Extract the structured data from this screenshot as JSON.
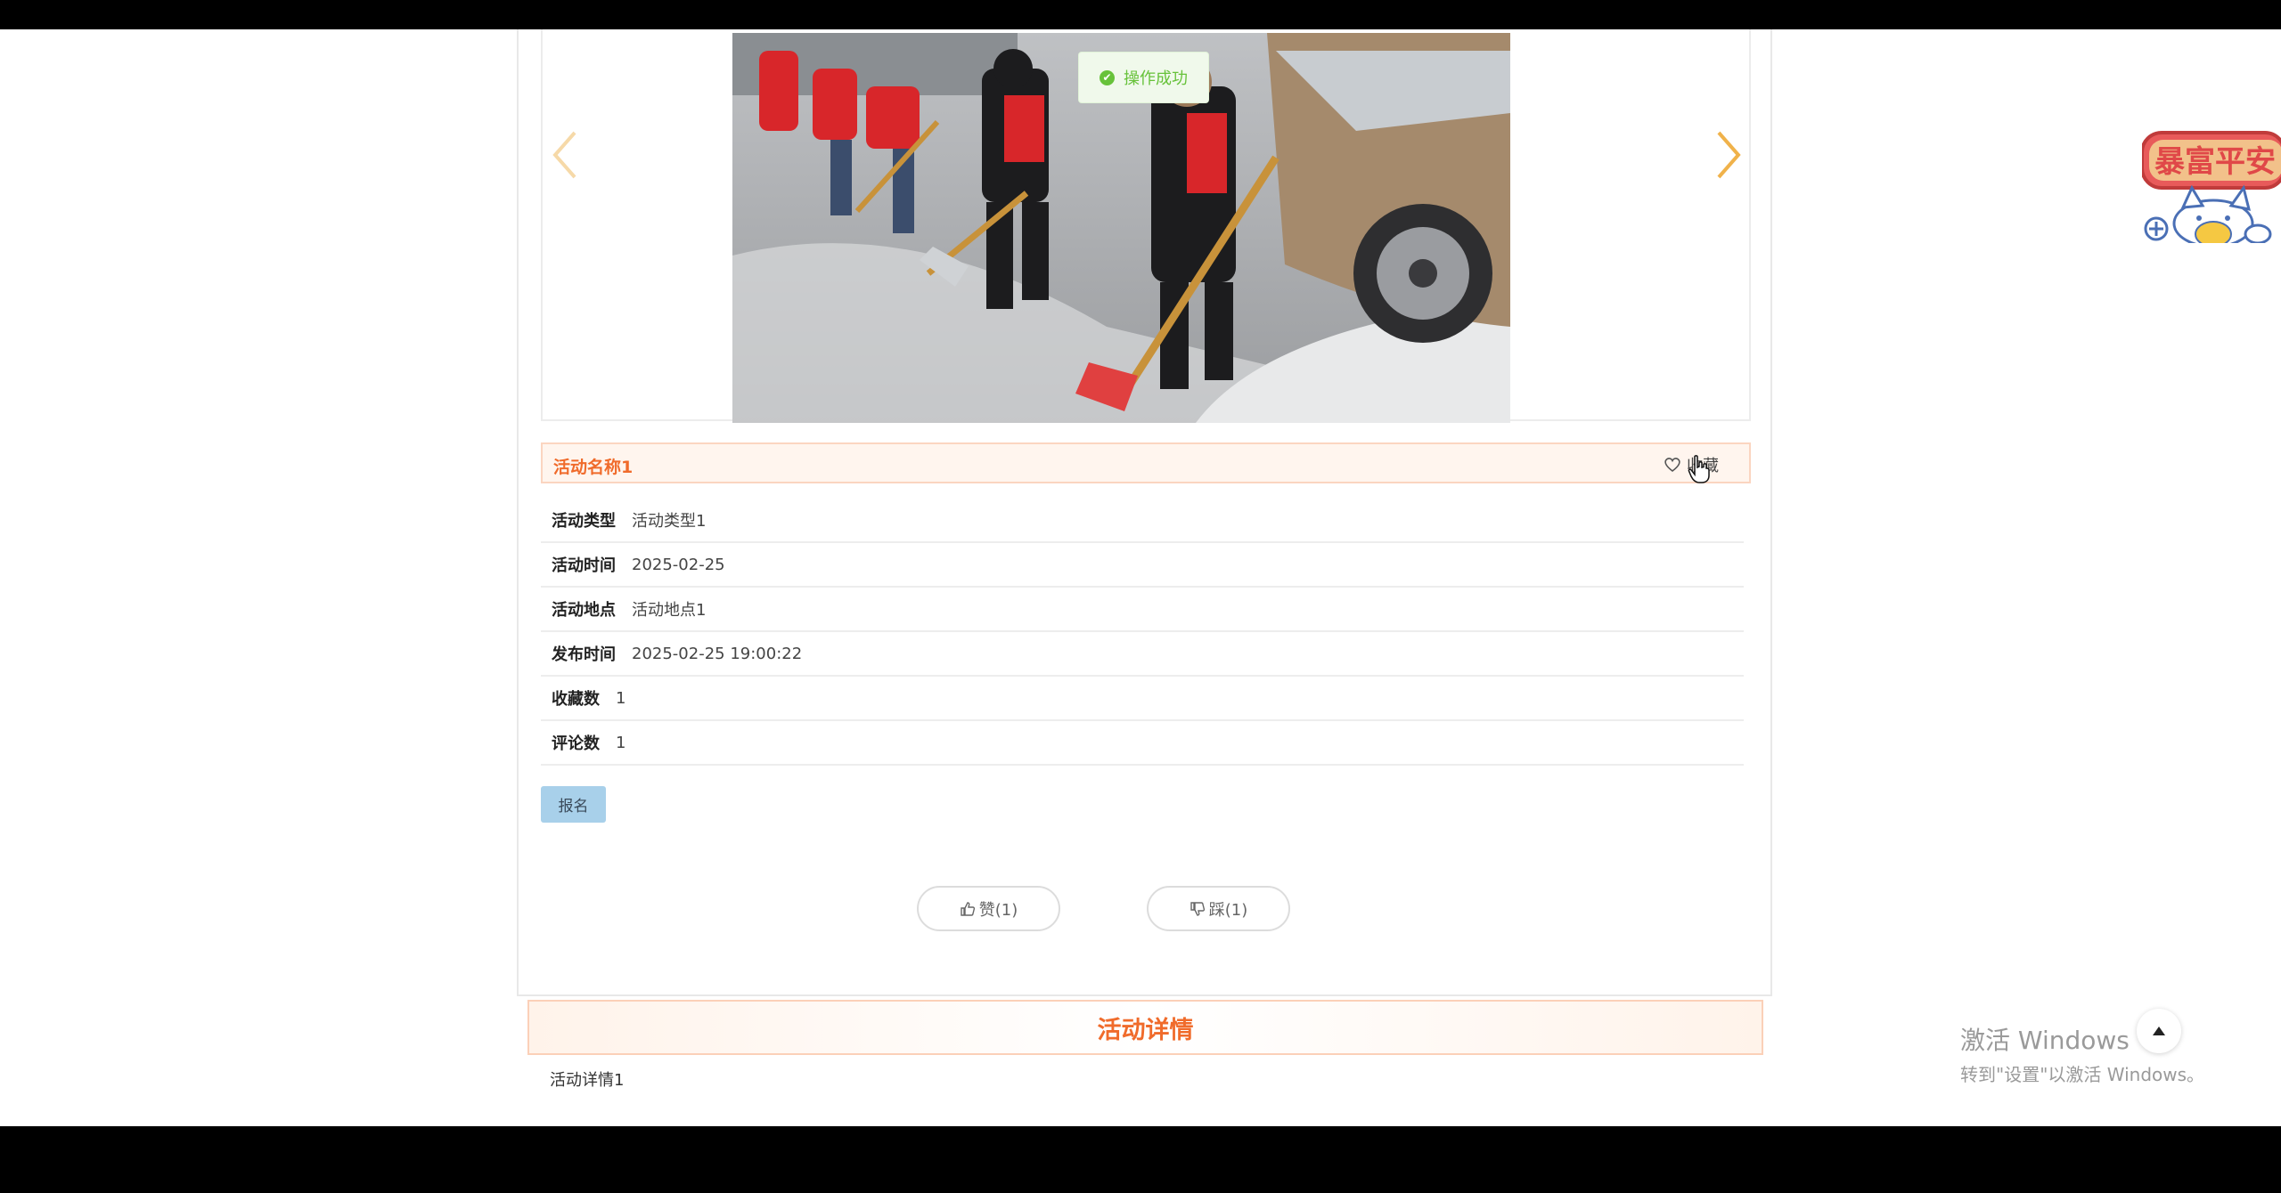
{
  "toast": {
    "message": "操作成功",
    "icon": "check-circle-icon"
  },
  "activity": {
    "name": "活动名称1",
    "favorite_label": "收藏",
    "rows": [
      {
        "label": "活动类型",
        "value": "活动类型1"
      },
      {
        "label": "活动时间",
        "value": "2025-02-25"
      },
      {
        "label": "活动地点",
        "value": "活动地点1"
      },
      {
        "label": "发布时间",
        "value": "2025-02-25 19:00:22"
      },
      {
        "label": "收藏数",
        "value": "1"
      },
      {
        "label": "评论数",
        "value": "1"
      }
    ],
    "signup_label": "报名",
    "like_label": "赞(1)",
    "dislike_label": "踩(1)"
  },
  "details": {
    "heading": "活动详情",
    "content": "活动详情1"
  },
  "mascot_banner": {
    "text": "暴富平安"
  },
  "windows_watermark": {
    "line1": "激活 Windows",
    "line2": "转到\"设置\"以激活 Windows。"
  },
  "colors": {
    "accent": "#f06b2b",
    "arrow": "#f0b24a",
    "signup": "#a8d0ea",
    "toast": "#67c23a"
  }
}
